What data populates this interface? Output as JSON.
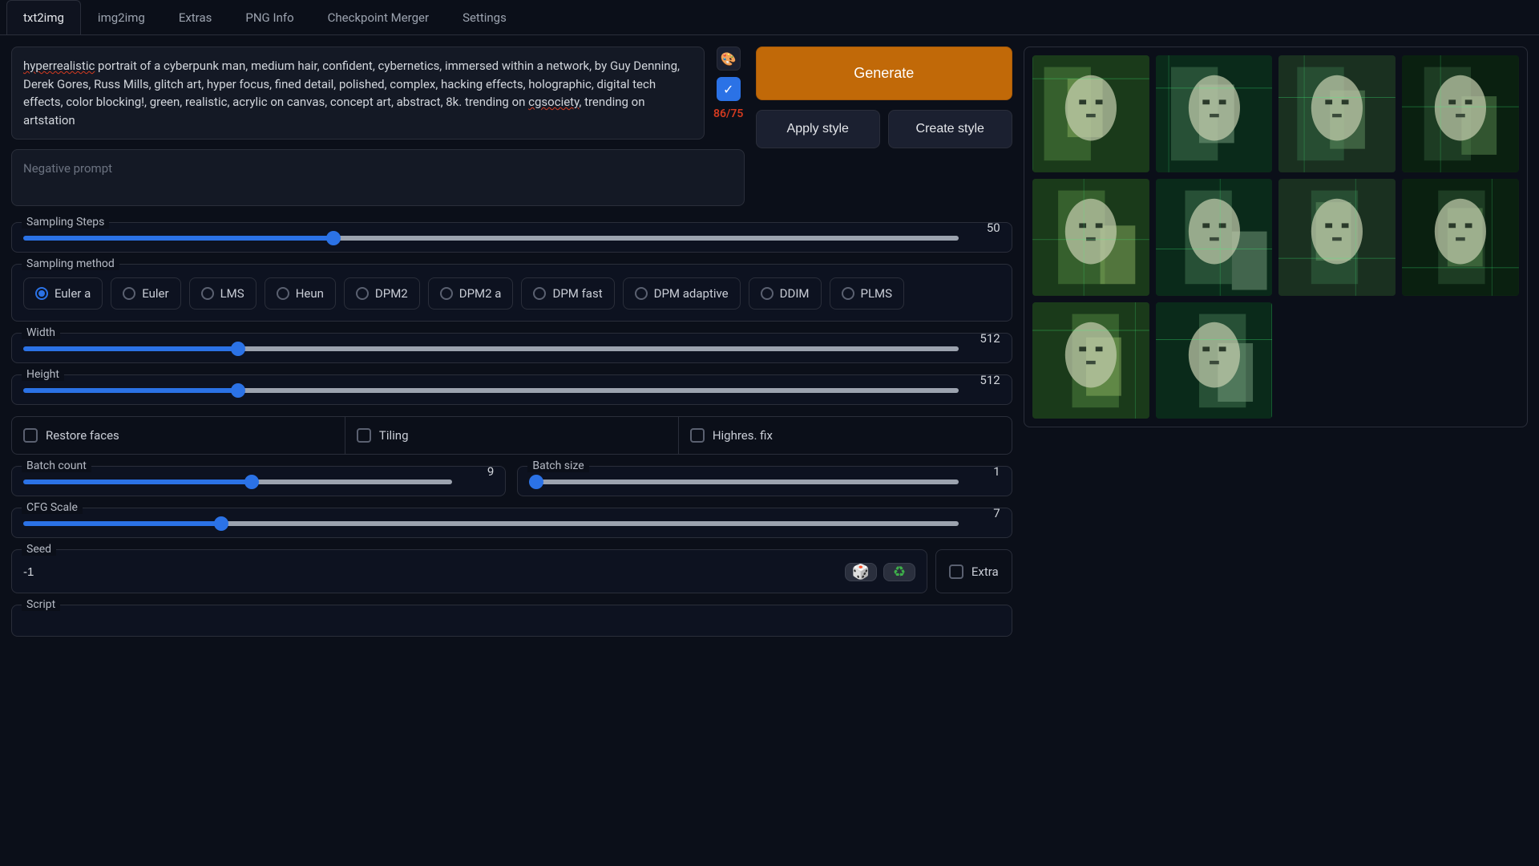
{
  "tabs": [
    "txt2img",
    "img2img",
    "Extras",
    "PNG Info",
    "Checkpoint Merger",
    "Settings"
  ],
  "active_tab": 0,
  "prompt": {
    "text_html": "<span class='spell-underline'>hyperrealistic</span> portrait of a cyberpunk man, medium hair, confident, cybernetics, immersed within a network, by Guy Denning, Derek Gores, Russ Mills, glitch art, hyper focus, fined detail, polished, complex, hacking effects, holographic, digital tech effects, color blocking!, green, realistic, acrylic on canvas, concept art, abstract, 8k. trending on <span class='spell-underline'>cgsociety</span>, trending on artstation",
    "token_count": "86/75",
    "neg_placeholder": "Negative prompt"
  },
  "side_icons": {
    "palette": "🎨",
    "check": "✓"
  },
  "actions": {
    "generate": "Generate",
    "apply_style": "Apply style",
    "create_style": "Create style"
  },
  "sampling_steps": {
    "label": "Sampling Steps",
    "value": 50,
    "min": 1,
    "max": 150
  },
  "sampling_method": {
    "label": "Sampling method",
    "options": [
      "Euler a",
      "Euler",
      "LMS",
      "Heun",
      "DPM2",
      "DPM2 a",
      "DPM fast",
      "DPM adaptive",
      "DDIM",
      "PLMS"
    ],
    "selected": 0
  },
  "width": {
    "label": "Width",
    "value": 512,
    "min": 64,
    "max": 2048
  },
  "height": {
    "label": "Height",
    "value": 512,
    "min": 64,
    "max": 2048
  },
  "checks": {
    "restore": "Restore faces",
    "tiling": "Tiling",
    "highres": "Highres. fix"
  },
  "batch_count": {
    "label": "Batch count",
    "value": 9,
    "min": 1,
    "max": 16
  },
  "batch_size": {
    "label": "Batch size",
    "value": 1,
    "min": 1,
    "max": 8
  },
  "cfg": {
    "label": "CFG Scale",
    "value": 7,
    "min": 1,
    "max": 30
  },
  "seed": {
    "label": "Seed",
    "value": "-1",
    "dice": "🎲",
    "recycle": "♻",
    "extra": "Extra"
  },
  "script": {
    "label": "Script"
  },
  "gallery_count": 10,
  "colors": {
    "accent": "#2b72e6",
    "primary_btn": "#c16908",
    "token_warn": "#d43a1f"
  }
}
